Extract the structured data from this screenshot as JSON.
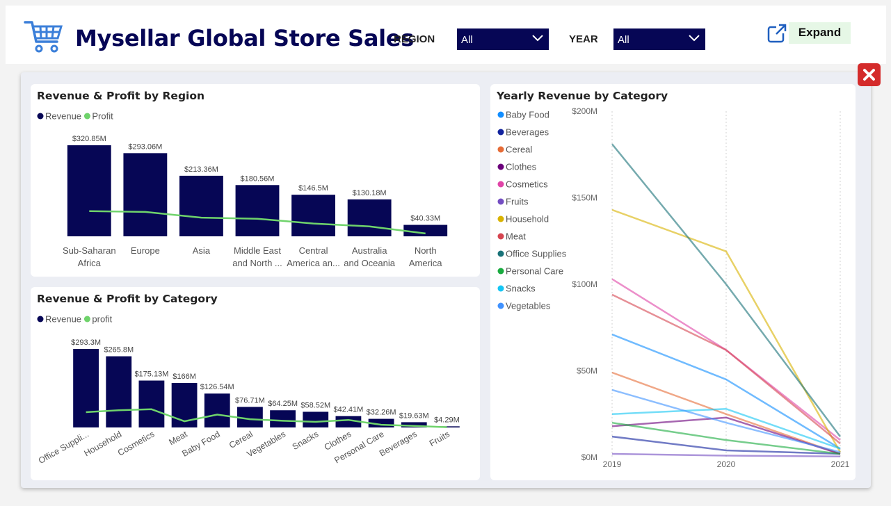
{
  "header": {
    "title": "Mysellar Global Store Sales",
    "region_label": "REGION",
    "region_value": "All",
    "year_label": "YEAR",
    "year_value": "All",
    "expand_label": "Expand",
    "icons": [
      "shopping-cart-icon",
      "chevron-down-icon",
      "external-link-icon",
      "close-icon"
    ]
  },
  "colors": {
    "navy": "#060655",
    "profit_green": "#6fd36b",
    "close_red": "#d42b2b"
  },
  "chart_data": [
    {
      "id": "region",
      "type": "bar",
      "title": "Revenue & Profit by Region",
      "categories": [
        "Sub-Saharan Africa",
        "Europe",
        "Asia",
        "Middle East and North ...",
        "Central America an...",
        "Australia and Oceania",
        "North America"
      ],
      "category_lines": [
        [
          "Sub-Saharan",
          "Africa"
        ],
        [
          "Europe"
        ],
        [
          "Asia"
        ],
        [
          "Middle East",
          "and North ..."
        ],
        [
          "Central",
          "America an..."
        ],
        [
          "Australia",
          "and Oceania"
        ],
        [
          "North",
          "America"
        ]
      ],
      "series": [
        {
          "name": "Revenue",
          "color": "#060655",
          "values": [
            320.85,
            293.06,
            213.36,
            180.56,
            146.5,
            130.18,
            40.33
          ],
          "labels": [
            "$320.85M",
            "$293.06M",
            "$213.36M",
            "$180.56M",
            "$146.5M",
            "$130.18M",
            "$40.33M"
          ]
        },
        {
          "name": "Profit",
          "color": "#6fd36b",
          "type": "line",
          "values": [
            89,
            86,
            66,
            62,
            45,
            35,
            10
          ]
        }
      ],
      "unit": "$M",
      "ylim": [
        0,
        320.85
      ],
      "legend_position": "top-left",
      "grid": false
    },
    {
      "id": "category",
      "type": "bar",
      "title": "Revenue & Profit by Category",
      "categories": [
        "Office Suppli...",
        "Household",
        "Cosmetics",
        "Meat",
        "Baby Food",
        "Cereal",
        "Vegetables",
        "Snacks",
        "Clothes",
        "Personal Care",
        "Beverages",
        "Fruits"
      ],
      "series": [
        {
          "name": "Revenue",
          "color": "#060655",
          "values": [
            293.3,
            265.8,
            175.13,
            166,
            126.54,
            76.71,
            64.25,
            58.52,
            42.41,
            32.26,
            19.63,
            4.29
          ],
          "labels": [
            "$293.3M",
            "$265.8M",
            "$175.13M",
            "$166M",
            "$126.54M",
            "$76.71M",
            "$64.25M",
            "$58.52M",
            "$42.41M",
            "$32.26M",
            "$19.63M",
            "$4.29M"
          ]
        },
        {
          "name": "profit",
          "color": "#6fd36b",
          "type": "line",
          "values": [
            57,
            64,
            68,
            23,
            48,
            31,
            25,
            21,
            28,
            10,
            6,
            1
          ]
        }
      ],
      "unit": "$M",
      "ylim": [
        0,
        293.3
      ],
      "legend_position": "top-left",
      "grid": false
    },
    {
      "id": "yearly",
      "type": "line",
      "title": "Yearly Revenue by Category",
      "x": [
        "2019",
        "2020",
        "2021"
      ],
      "y_ticks": [
        "$0M",
        "$50M",
        "$100M",
        "$150M",
        "$200M"
      ],
      "ylim": [
        0,
        200
      ],
      "legend_position": "left",
      "grid": "vertical dotted",
      "series": [
        {
          "name": "Baby Food",
          "color": "#118dff",
          "values": [
            71,
            45,
            5
          ]
        },
        {
          "name": "Beverages",
          "color": "#12239e",
          "values": [
            12,
            4,
            2
          ]
        },
        {
          "name": "Cereal",
          "color": "#e66c37",
          "values": [
            49,
            25,
            2
          ]
        },
        {
          "name": "Clothes",
          "color": "#6b007b",
          "values": [
            18,
            23,
            2
          ]
        },
        {
          "name": "Cosmetics",
          "color": "#e044a7",
          "values": [
            103,
            62,
            10
          ]
        },
        {
          "name": "Fruits",
          "color": "#744ec2",
          "values": [
            2,
            1,
            0.5
          ]
        },
        {
          "name": "Household",
          "color": "#d9b300",
          "values": [
            143,
            119,
            3
          ]
        },
        {
          "name": "Meat",
          "color": "#d64550",
          "values": [
            94,
            62,
            8
          ]
        },
        {
          "name": "Office Supplies",
          "color": "#197278",
          "values": [
            181,
            100,
            12
          ]
        },
        {
          "name": "Personal Care",
          "color": "#1aab40",
          "values": [
            20,
            10,
            2
          ]
        },
        {
          "name": "Snacks",
          "color": "#15c6f4",
          "values": [
            25,
            28,
            5
          ]
        },
        {
          "name": "Vegetables",
          "color": "#4092ff",
          "values": [
            39,
            20,
            3
          ]
        }
      ]
    }
  ]
}
